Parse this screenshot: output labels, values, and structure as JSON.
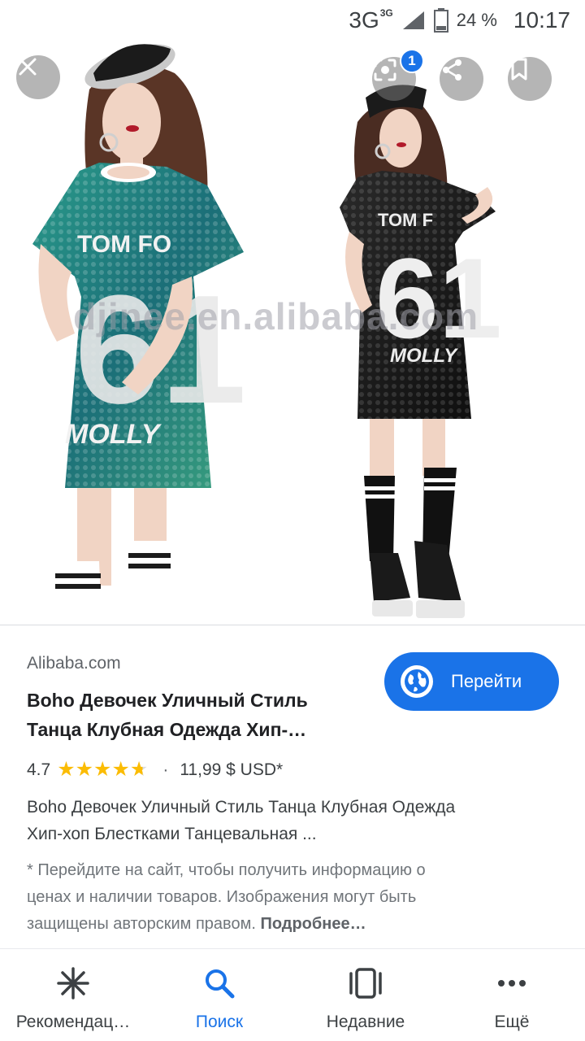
{
  "status_bar": {
    "network": "3G",
    "network_sup": "3G",
    "battery": "24 %",
    "time": "10:17"
  },
  "image": {
    "watermark": "djinee.en.alibaba.com",
    "lens_badge": "1",
    "left_jersey": {
      "top_text": "TOM FO",
      "number": "61",
      "bottom_text": "MOLLY"
    },
    "right_jersey": {
      "top_text": "TOM F",
      "number": "61",
      "bottom_text": "MOLLY"
    }
  },
  "result": {
    "source": "Alibaba.com",
    "title_line1": "Boho Девочек Уличный Стиль",
    "title_line2": "Танца Клубная Одежда Хип-…",
    "visit_label": "Перейти",
    "rating": "4.7",
    "rating_value": 4.7,
    "separator": "·",
    "price": "11,99 $ USD*",
    "desc_line1": "Boho Девочек Уличный Стиль Танца Клубная Одежда",
    "desc_line2": "Хип-хоп Блестками Танцевальная ...",
    "disclaimer_line1": "* Перейдите на сайт, чтобы получить информацию о",
    "disclaimer_line2": "ценах и наличии товаров. Изображения могут быть",
    "disclaimer_line3": "защищены авторским правом.",
    "more_link": "Подробнее…"
  },
  "nav": {
    "items": [
      {
        "label": "Рекомендац…",
        "icon": "asterisk-icon"
      },
      {
        "label": "Поиск",
        "icon": "search-icon"
      },
      {
        "label": "Недавние",
        "icon": "recent-cards-icon"
      },
      {
        "label": "Ещё",
        "icon": "more-dots-icon"
      }
    ]
  },
  "colors": {
    "accent": "#1a73e8",
    "star": "#fbbc04",
    "star_empty": "#dadce0",
    "green_sequin": "#1e8a7a",
    "black_sequin": "#1a1a1a"
  }
}
